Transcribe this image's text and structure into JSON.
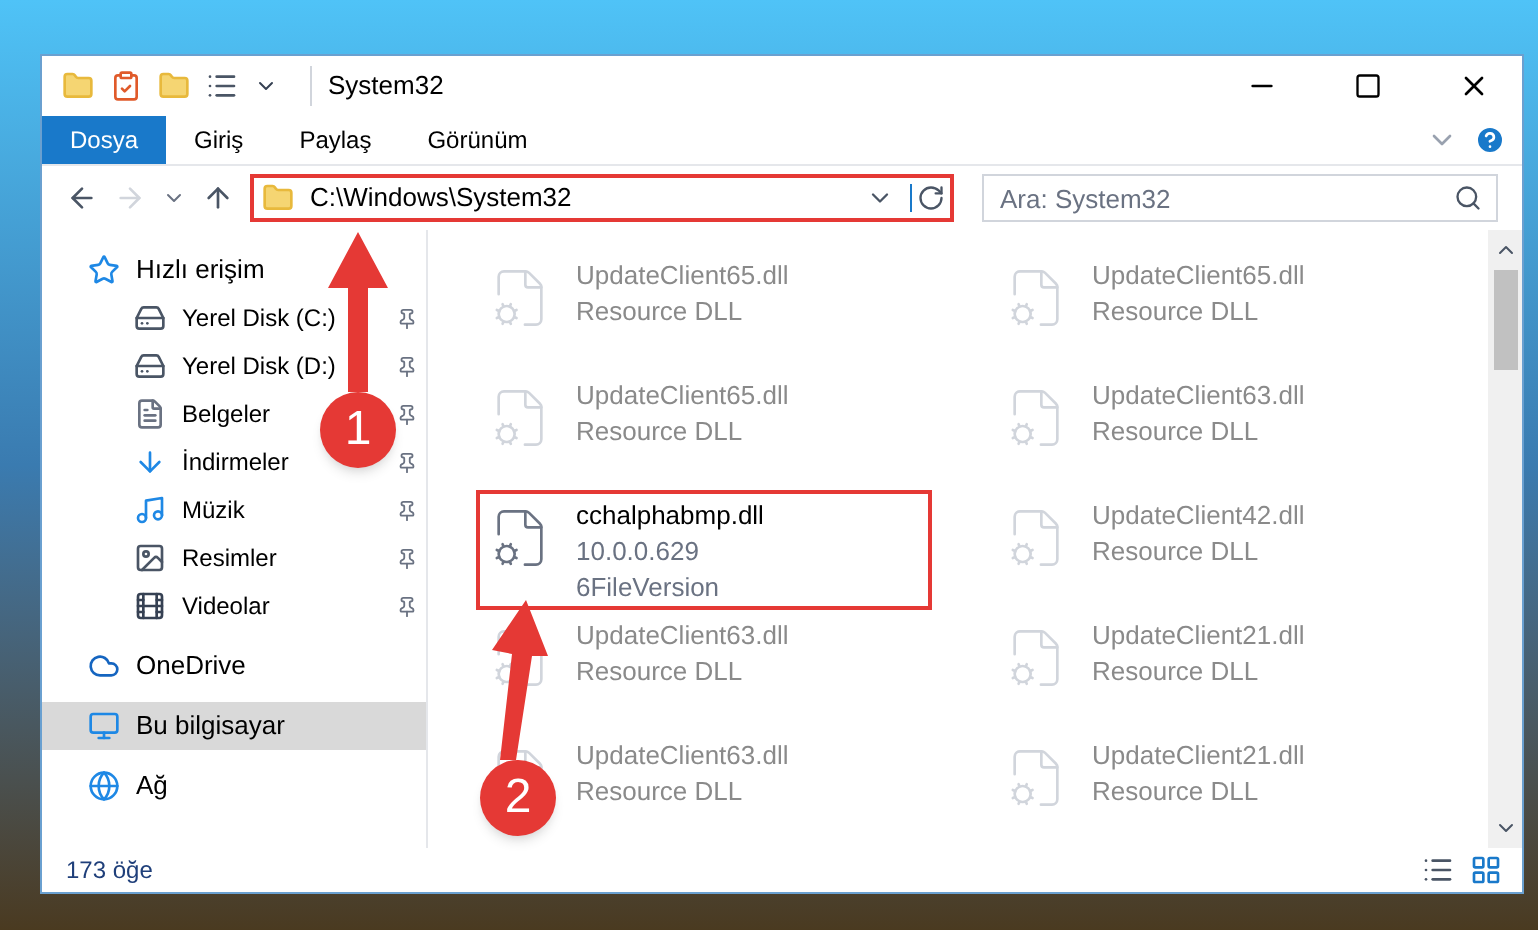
{
  "window": {
    "title": "System32"
  },
  "ribbon_tabs": [
    {
      "label": "Dosya",
      "selected": true
    },
    {
      "label": "Giriş",
      "selected": false
    },
    {
      "label": "Paylaş",
      "selected": false
    },
    {
      "label": "Görünüm",
      "selected": false
    }
  ],
  "address": {
    "path": "C:\\Windows\\System32"
  },
  "search": {
    "placeholder": "Ara: System32"
  },
  "sidebar": {
    "items": [
      {
        "label": "Hızlı erişim",
        "kind": "star",
        "selected": false,
        "children": [
          {
            "label": "Yerel Disk (C:)",
            "kind": "drive",
            "pinned": true
          },
          {
            "label": "Yerel Disk (D:)",
            "kind": "drive",
            "pinned": true
          },
          {
            "label": "Belgeler",
            "kind": "document",
            "pinned": true
          },
          {
            "label": "İndirmeler",
            "kind": "download",
            "pinned": true
          },
          {
            "label": "Müzik",
            "kind": "music",
            "pinned": true
          },
          {
            "label": "Resimler",
            "kind": "picture",
            "pinned": true
          },
          {
            "label": "Videolar",
            "kind": "video",
            "pinned": true
          }
        ]
      },
      {
        "label": "OneDrive",
        "kind": "cloud",
        "selected": false
      },
      {
        "label": "Bu bilgisayar",
        "kind": "computer",
        "selected": true
      },
      {
        "label": "Ağ",
        "kind": "network",
        "selected": false
      }
    ]
  },
  "files": [
    {
      "name": "UpdateClient65.dll",
      "lines": [
        "Resource DLL"
      ],
      "focused": false
    },
    {
      "name": "UpdateClient65.dll",
      "lines": [
        "Resource DLL"
      ],
      "focused": false
    },
    {
      "name": "UpdateClient65.dll",
      "lines": [
        "Resource DLL"
      ],
      "focused": false
    },
    {
      "name": "UpdateClient63.dll",
      "lines": [
        "Resource DLL"
      ],
      "focused": false
    },
    {
      "name": "cchalphabmp.dll",
      "lines": [
        "10.0.0.629",
        "6FileVersion"
      ],
      "focused": true
    },
    {
      "name": "UpdateClient42.dll",
      "lines": [
        "Resource DLL"
      ],
      "focused": false
    },
    {
      "name": "UpdateClient63.dll",
      "lines": [
        "Resource DLL"
      ],
      "focused": false
    },
    {
      "name": "UpdateClient21.dll",
      "lines": [
        "Resource DLL"
      ],
      "focused": false
    },
    {
      "name": "UpdateClient63.dll",
      "lines": [
        "Resource DLL"
      ],
      "focused": false
    },
    {
      "name": "UpdateClient21.dll",
      "lines": [
        "Resource DLL"
      ],
      "focused": false
    }
  ],
  "annotations": [
    {
      "number": "1"
    },
    {
      "number": "2"
    }
  ],
  "status_bar": {
    "count": "173 öğe"
  }
}
